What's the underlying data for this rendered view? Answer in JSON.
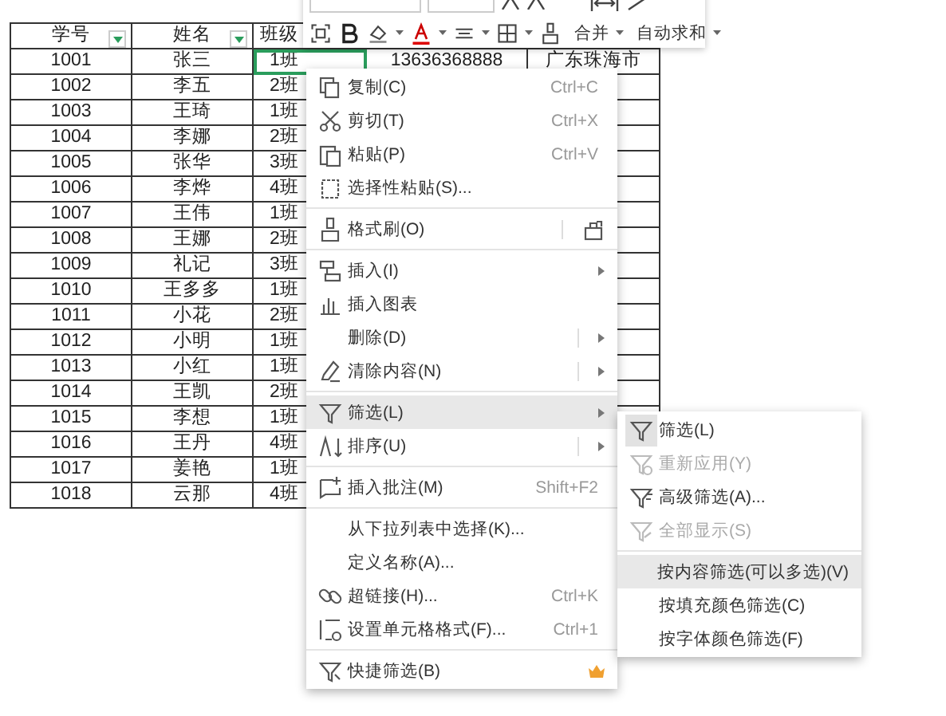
{
  "table": {
    "columns": [
      {
        "label": "学号",
        "filter": true
      },
      {
        "label": "姓名",
        "filter": true
      },
      {
        "label": "班级",
        "filter": false
      }
    ],
    "rows": [
      [
        "1001",
        "张三",
        "1班",
        "13636368888",
        "广东珠海市"
      ],
      [
        "1002",
        "李五",
        "2班"
      ],
      [
        "1003",
        "王琦",
        "1班"
      ],
      [
        "1004",
        "李娜",
        "2班"
      ],
      [
        "1005",
        "张华",
        "3班"
      ],
      [
        "1006",
        "李烨",
        "4班"
      ],
      [
        "1007",
        "王伟",
        "1班"
      ],
      [
        "1008",
        "王娜",
        "2班"
      ],
      [
        "1009",
        "礼记",
        "3班"
      ],
      [
        "1010",
        "王多多",
        "1班"
      ],
      [
        "1011",
        "小花",
        "2班"
      ],
      [
        "1012",
        "小明",
        "1班"
      ],
      [
        "1013",
        "小红",
        "1班"
      ],
      [
        "1014",
        "王凯",
        "2班"
      ],
      [
        "1015",
        "李想",
        "1班"
      ],
      [
        "1016",
        "王丹",
        "4班"
      ],
      [
        "1017",
        "姜艳",
        "1班"
      ],
      [
        "1018",
        "云那",
        "4班"
      ]
    ]
  },
  "toolbar": {
    "buttons": [
      "合并",
      "自动求和"
    ]
  },
  "context_menu": {
    "groups": [
      [
        {
          "label": "复制(C)",
          "shortcut": "Ctrl+C",
          "submenu": false,
          "selected": false
        },
        {
          "label": "剪切(T)",
          "shortcut": "Ctrl+X",
          "submenu": false,
          "selected": false
        },
        {
          "label": "粘贴(P)",
          "shortcut": "Ctrl+V",
          "submenu": false,
          "selected": false
        },
        {
          "label": "选择性粘贴(S)...",
          "submenu": false,
          "selected": false
        }
      ],
      [
        {
          "label": "格式刷(O)",
          "submenu": false,
          "selected": false
        }
      ],
      [
        {
          "label": "插入(I)",
          "submenu": true,
          "selected": false
        },
        {
          "label": "插入图表",
          "submenu": false,
          "selected": false
        },
        {
          "label": "删除(D)",
          "submenu": true,
          "selected": false
        },
        {
          "label": "清除内容(N)",
          "submenu": true,
          "selected": false
        }
      ],
      [
        {
          "label": "筛选(L)",
          "submenu": true,
          "selected": true
        },
        {
          "label": "排序(U)",
          "submenu": true,
          "selected": false
        }
      ],
      [
        {
          "label": "插入批注(M)",
          "shortcut": "Shift+F2",
          "submenu": false,
          "selected": false
        }
      ],
      [
        {
          "label": "从下拉列表中选择(K)...",
          "submenu": false,
          "selected": false
        },
        {
          "label": "定义名称(A)...",
          "submenu": false,
          "selected": false
        },
        {
          "label": "超链接(H)...",
          "shortcut": "Ctrl+K",
          "submenu": false,
          "selected": false
        },
        {
          "label": "设置单元格格式(F)...",
          "shortcut": "Ctrl+1",
          "submenu": false,
          "selected": false
        }
      ],
      [
        {
          "label": "快捷筛选(B)",
          "submenu": false,
          "selected": false
        }
      ]
    ]
  },
  "submenu": {
    "groups": [
      [
        {
          "label": "筛选(L)",
          "disabled": false,
          "selected": false
        },
        {
          "label": "重新应用(Y)",
          "disabled": true,
          "selected": false
        },
        {
          "label": "高级筛选(A)...",
          "disabled": false,
          "selected": false
        },
        {
          "label": "全部显示(S)",
          "disabled": true,
          "selected": false
        }
      ],
      [
        {
          "label": "按内容筛选(可以多选)(V)",
          "disabled": false,
          "selected": true
        },
        {
          "label": "按填充颜色筛选(C)",
          "disabled": false,
          "selected": false
        },
        {
          "label": "按字体颜色筛选(F)",
          "disabled": false,
          "selected": false
        }
      ]
    ]
  }
}
